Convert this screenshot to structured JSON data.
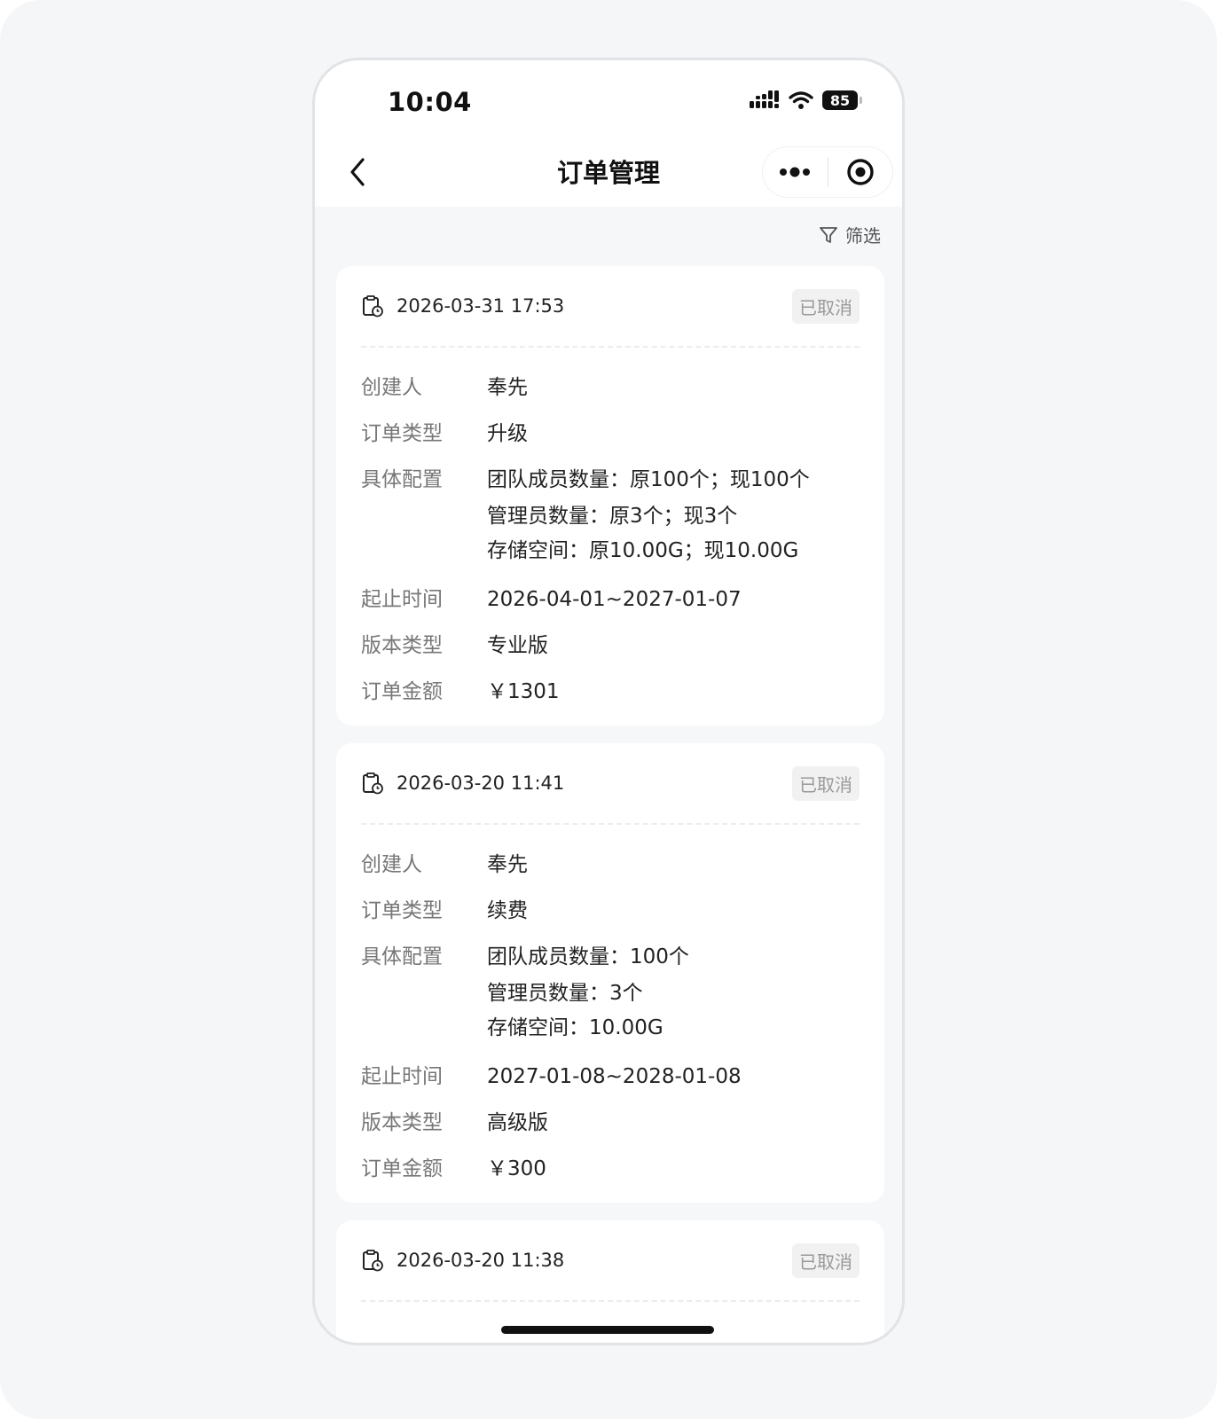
{
  "status": {
    "time": "10:04",
    "battery": "85"
  },
  "nav": {
    "title": "订单管理"
  },
  "toolbar": {
    "filter_label": "筛选"
  },
  "labels": {
    "creator": "创建人",
    "order_type": "订单类型",
    "config": "具体配置",
    "period": "起止时间",
    "edition": "版本类型",
    "amount": "订单金额"
  },
  "orders": [
    {
      "datetime": "2026-03-31 17:53",
      "status": "已取消",
      "creator": "奉先",
      "order_type": "升级",
      "config": [
        "团队成员数量：原100个；现100个",
        "管理员数量：原3个；现3个",
        "存储空间：原10.00G；现10.00G"
      ],
      "period": "2026-04-01~2027-01-07",
      "edition": "专业版",
      "amount": "￥1301"
    },
    {
      "datetime": "2026-03-20 11:41",
      "status": "已取消",
      "creator": "奉先",
      "order_type": "续费",
      "config": [
        "团队成员数量：100个",
        "管理员数量：3个",
        "存储空间：10.00G"
      ],
      "period": "2027-01-08~2028-01-08",
      "edition": "高级版",
      "amount": "￥300"
    },
    {
      "datetime": "2026-03-20 11:38",
      "status": "已取消"
    }
  ]
}
